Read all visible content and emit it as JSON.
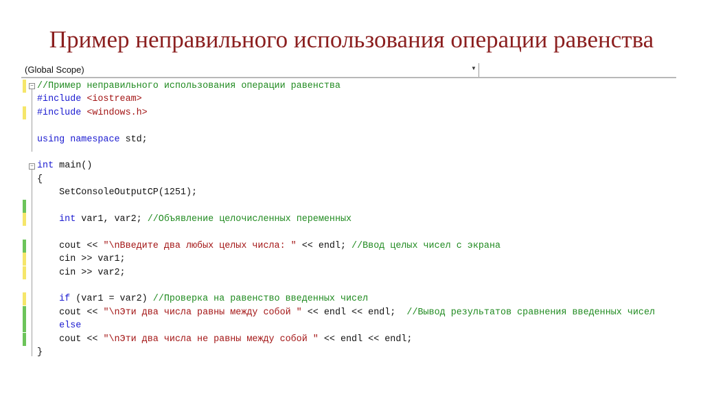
{
  "title": "Пример неправильного использования операции равенства",
  "scope_dropdown": {
    "value": "(Global Scope)",
    "icon": "chevron-down-icon"
  },
  "colors": {
    "title": "#8b1f1f",
    "comment": "#1f8a1f",
    "keyword": "#1a1ad0",
    "string": "#a31515",
    "marker_yellow": "#f5e66a",
    "marker_green": "#6cc45a"
  },
  "code": [
    {
      "marker": "yellow",
      "tokens": [
        [
          "comment",
          "//Пример неправильного использования операции равенства"
        ]
      ]
    },
    {
      "marker": "",
      "tokens": [
        [
          "pp",
          "#include "
        ],
        [
          "inc",
          "<iostream>"
        ]
      ]
    },
    {
      "marker": "yellow",
      "tokens": [
        [
          "pp",
          "#include "
        ],
        [
          "inc",
          "<windows.h>"
        ]
      ]
    },
    {
      "marker": "",
      "tokens": []
    },
    {
      "marker": "",
      "tokens": [
        [
          "kw",
          "using namespace "
        ],
        [
          "plain",
          "std;"
        ]
      ]
    },
    {
      "marker": "",
      "tokens": []
    },
    {
      "marker": "",
      "tokens": [
        [
          "kw",
          "int "
        ],
        [
          "plain",
          "main()"
        ]
      ]
    },
    {
      "marker": "",
      "tokens": [
        [
          "plain",
          "{"
        ]
      ]
    },
    {
      "marker": "",
      "tokens": [
        [
          "plain",
          "    SetConsoleOutputCP(1251);"
        ]
      ]
    },
    {
      "marker": "green",
      "tokens": []
    },
    {
      "marker": "yellow",
      "tokens": [
        [
          "kw",
          "    int "
        ],
        [
          "plain",
          "var1, var2; "
        ],
        [
          "comment",
          "//Объявление целочисленных переменных"
        ]
      ]
    },
    {
      "marker": "",
      "tokens": []
    },
    {
      "marker": "green",
      "tokens": [
        [
          "plain",
          "    cout << "
        ],
        [
          "str",
          "\"\\nВведите два любых целых числа: \""
        ],
        [
          "plain",
          " << endl; "
        ],
        [
          "comment",
          "//Ввод целых чисел с экрана"
        ]
      ]
    },
    {
      "marker": "yellow",
      "tokens": [
        [
          "plain",
          "    cin >> var1;"
        ]
      ]
    },
    {
      "marker": "yellow",
      "tokens": [
        [
          "plain",
          "    cin >> var2;"
        ]
      ]
    },
    {
      "marker": "",
      "tokens": []
    },
    {
      "marker": "yellow",
      "tokens": [
        [
          "kw",
          "    if "
        ],
        [
          "plain",
          "(var1 = var2) "
        ],
        [
          "comment",
          "//Проверка на равенство введенных чисел"
        ]
      ]
    },
    {
      "marker": "green",
      "tokens": [
        [
          "plain",
          "    cout << "
        ],
        [
          "str",
          "\"\\nЭти два числа равны между собой \""
        ],
        [
          "plain",
          " << endl << endl;  "
        ],
        [
          "comment",
          "//Вывод результатов сравнения введенных чисел"
        ]
      ]
    },
    {
      "marker": "green",
      "tokens": [
        [
          "kw",
          "    else"
        ]
      ]
    },
    {
      "marker": "green",
      "tokens": [
        [
          "plain",
          "    cout << "
        ],
        [
          "str",
          "\"\\nЭти два числа не равны между собой \""
        ],
        [
          "plain",
          " << endl << endl;"
        ]
      ]
    },
    {
      "marker": "",
      "tokens": [
        [
          "plain",
          "}"
        ]
      ]
    }
  ]
}
